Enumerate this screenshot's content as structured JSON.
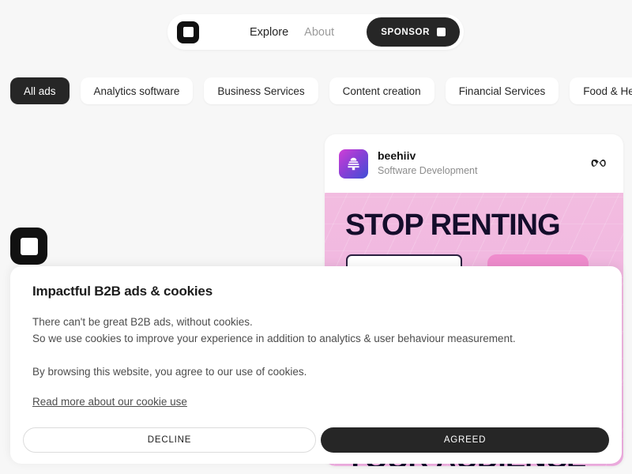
{
  "navbar": {
    "logo_icon": "rounded-square-logo-icon",
    "links": [
      {
        "label": "Explore",
        "active": true
      },
      {
        "label": "About",
        "active": false
      }
    ],
    "sponsor_button": {
      "label": "SPONSOR",
      "icon": "white-square-icon",
      "bg_color": "#262626",
      "text_color": "#ffffff"
    }
  },
  "filters": {
    "chips": [
      {
        "label": "All ads",
        "active": true
      },
      {
        "label": "Analytics software",
        "active": false
      },
      {
        "label": "Business Services",
        "active": false
      },
      {
        "label": "Content creation",
        "active": false
      },
      {
        "label": "Financial Services",
        "active": false
      },
      {
        "label": "Food & Health",
        "active": false
      }
    ],
    "active_bg": "#262626"
  },
  "floating_logo": {
    "icon": "rounded-square-logo-icon"
  },
  "ad_card": {
    "brand": {
      "name": "beehiiv",
      "category": "Software Development",
      "logo_icon": "beehive-icon",
      "logo_gradient_from": "#d13fd6",
      "logo_gradient_to": "#3f4fd6"
    },
    "platform_icon": "meta-infinity-icon",
    "creative": {
      "headline_top": "STOP RENTING",
      "headline_bottom": "YOUR AUDIENCE",
      "bg_color": "#f0b4dd",
      "text_color": "#140d2b",
      "mock_input_icon": "avatar-dot-icon",
      "mock_button_color": "#ef8ccd"
    }
  },
  "cookie_banner": {
    "title": "Impactful B2B ads & cookies",
    "line_1": "There can't be great B2B ads, without cookies.",
    "line_2": "So we use cookies to improve your experience in addition to analytics & user behaviour measurement.",
    "line_3": "By browsing this website, you agree to our use of cookies.",
    "link_text": "Read more about our cookie use",
    "decline_label": "DECLINE",
    "agreed_label": "AGREED",
    "agreed_bg": "#262626"
  }
}
